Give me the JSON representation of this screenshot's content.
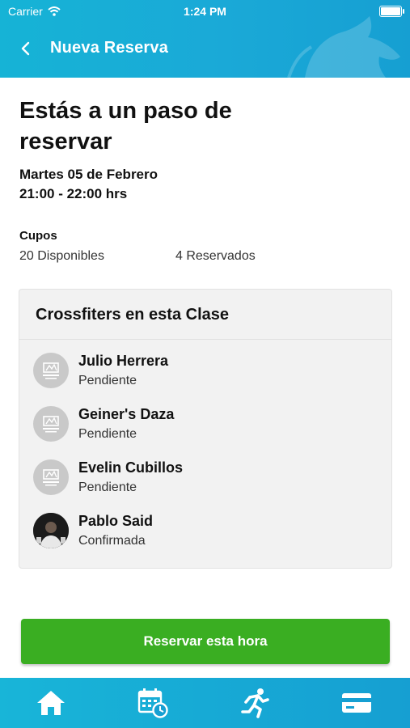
{
  "status_bar": {
    "carrier": "Carrier",
    "time": "1:24 PM"
  },
  "nav": {
    "title": "Nueva Reserva",
    "back_icon": "chevron-left-icon"
  },
  "headline": "Estás a un paso de reservar",
  "date_line": "Martes 05 de Febrero",
  "time_line": "21:00 - 22:00 hrs",
  "slots": {
    "title": "Cupos",
    "available": "20 Disponibles",
    "reserved": "4 Reservados"
  },
  "class_card": {
    "title": "Crossfiters en esta Clase",
    "members": [
      {
        "name": "Julio Herrera",
        "status": "Pendiente",
        "avatar": "logo"
      },
      {
        "name": "Geiner's Daza",
        "status": "Pendiente",
        "avatar": "logo"
      },
      {
        "name": "Evelin Cubillos",
        "status": "Pendiente",
        "avatar": "logo"
      },
      {
        "name": "Pablo Said",
        "status": "Confirmada",
        "avatar": "photo"
      }
    ]
  },
  "cta": {
    "label": "Reservar esta hora",
    "color": "#3aae22"
  },
  "colors": {
    "header": "#16b3d6",
    "tabbar": "#169fd2"
  },
  "tabbar": {
    "icons": [
      "home-icon",
      "calendar-clock-icon",
      "running-icon",
      "credit-card-icon"
    ]
  }
}
